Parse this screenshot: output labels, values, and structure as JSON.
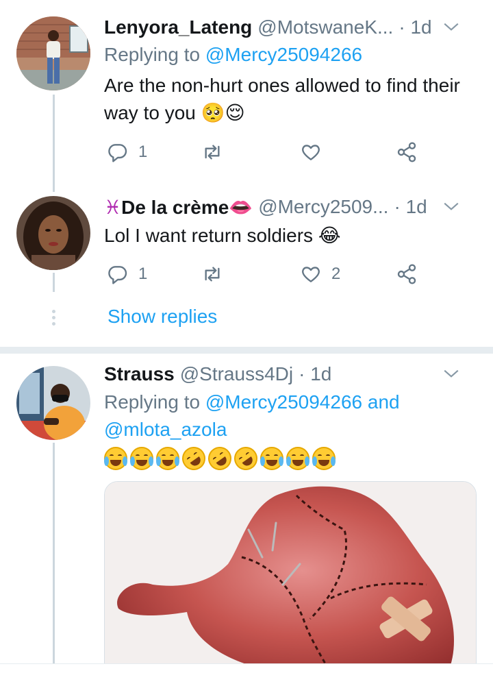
{
  "tweets": [
    {
      "name": "Lenyora_Lateng",
      "handle": "@MotswaneK...",
      "time": "· 1d",
      "reply_prefix": "Replying to",
      "reply_to": "@Mercy25094266",
      "text": "Are the non-hurt ones allowed to find their way to you 🥺😌",
      "replies": "1",
      "retweets": "",
      "likes": ""
    },
    {
      "name_prefix": "♓",
      "name": "De la crème👄",
      "handle": "@Mercy2509...",
      "time": "· 1d",
      "text": "Lol I want return soldiers 😂",
      "replies": "1",
      "retweets": "",
      "likes": "2",
      "show_replies": "Show replies"
    },
    {
      "name": "Strauss",
      "handle": "@Strauss4Dj",
      "time": "· 1d",
      "reply_prefix": "Replying to",
      "reply_to": "@Mercy25094266 and",
      "reply_to_2": "@mlota_azola",
      "text": "😭😭😭🤣🤣🤣😂😂😂",
      "media": "stitched-heart-image"
    }
  ],
  "icons": {
    "reply": "reply-icon",
    "retweet": "retweet-icon",
    "like": "heart-icon",
    "share": "share-icon",
    "menu": "chevron-down-icon"
  },
  "colors": {
    "link": "#1da1f2",
    "muted": "#657786",
    "thread": "#ccd6dd",
    "separator": "#e6ecf0"
  }
}
